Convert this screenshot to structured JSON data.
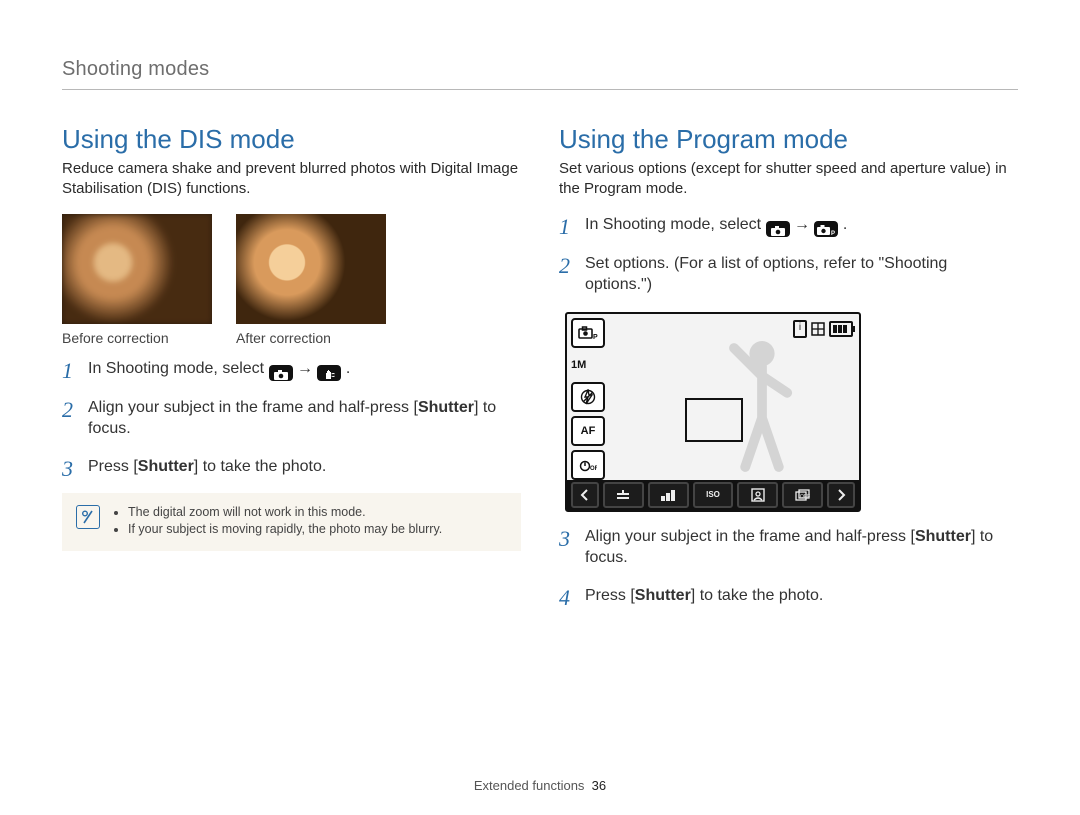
{
  "section_header": "Shooting modes",
  "left": {
    "heading": "Using the DIS mode",
    "intro": "Reduce camera shake and prevent blurred photos with Digital Image Stabilisation (DIS) functions.",
    "caption_before": "Before correction",
    "caption_after": "After correction",
    "steps": [
      {
        "pre": "In Shooting mode, select ",
        "icon1": "camera-icon",
        "arrow": " → ",
        "icon2": "dis-hand-icon",
        "post": "."
      },
      {
        "pre": "Align your subject in the frame and half-press [",
        "strong": "Shutter",
        "post": "] to focus."
      },
      {
        "pre": "Press [",
        "strong": "Shutter",
        "post": "] to take the photo."
      }
    ],
    "notes": [
      "The digital zoom will not work in this mode.",
      "If your subject is moving rapidly, the photo may be blurry."
    ]
  },
  "right": {
    "heading": "Using the Program mode",
    "intro": "Set various options (except for shutter speed and aperture value) in the Program mode.",
    "steps_top": [
      {
        "pre": "In Shooting mode, select ",
        "icon1": "camera-icon",
        "arrow": " → ",
        "icon2": "camera-p-icon",
        "post": "."
      },
      {
        "pre": "Set options. (For a list of options, refer to \"Shooting options.\")",
        "strong": "",
        "post": ""
      }
    ],
    "lcd": {
      "mode_icon": "camera-p-icon",
      "res_label": "1M",
      "left_icons": [
        "flash-off-icon",
        "AF",
        "off-icon"
      ],
      "battery_cells": 3,
      "bottom_icons": [
        "chevron-left-icon",
        "ev-icon",
        "wb-icon",
        "iso-icon",
        "face-icon",
        "drive-icon",
        "chevron-right-icon"
      ]
    },
    "steps_bottom": [
      {
        "num": 3,
        "pre": "Align your subject in the frame and half-press [",
        "strong": "Shutter",
        "post": "] to focus."
      },
      {
        "num": 4,
        "pre": "Press [",
        "strong": "Shutter",
        "post": "] to take the photo."
      }
    ]
  },
  "footer": {
    "section": "Extended functions",
    "page": "36"
  }
}
